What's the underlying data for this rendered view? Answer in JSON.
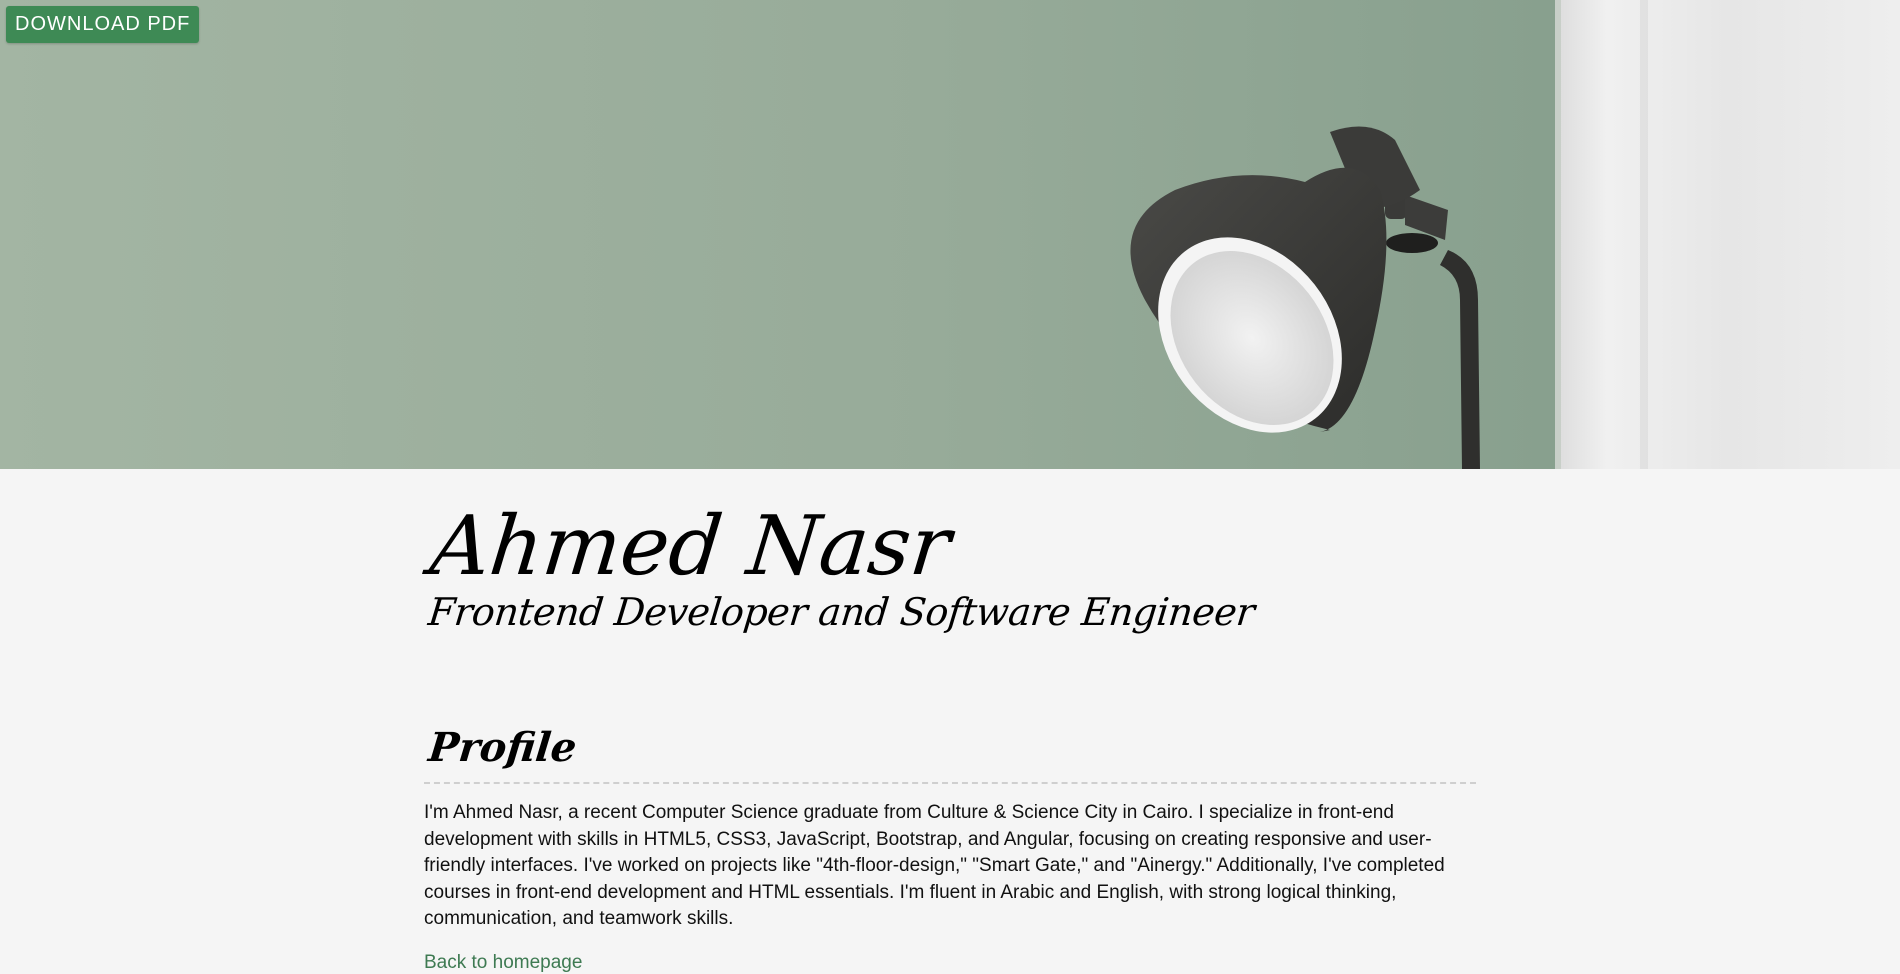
{
  "header": {
    "download_label": "DOWNLOAD PDF"
  },
  "hero": {
    "image": "wall-lamp-photo",
    "wall_color": "#98ab9a",
    "lamp_color": "#3a3a38"
  },
  "person": {
    "name": "Ahmed Nasr",
    "title": "Frontend Developer and Software Engineer"
  },
  "profile": {
    "heading": "Profile",
    "body": "I'm Ahmed Nasr, a recent Computer Science graduate from Culture & Science City in Cairo. I specialize in front-end development with skills in HTML5, CSS3, JavaScript, Bootstrap, and Angular, focusing on creating responsive and user-friendly interfaces. I've worked on projects like \"4th-floor-design,\" \"Smart Gate,\" and \"Ainergy.\" Additionally, I've completed courses in front-end development and HTML essentials. I'm fluent in Arabic and English, with strong logical thinking, communication, and teamwork skills."
  },
  "footer": {
    "back_link_label": "Back to homepage"
  },
  "colors": {
    "accent": "#3e8a55",
    "link": "#3e7a52",
    "page_bg": "#f5f5f5"
  }
}
